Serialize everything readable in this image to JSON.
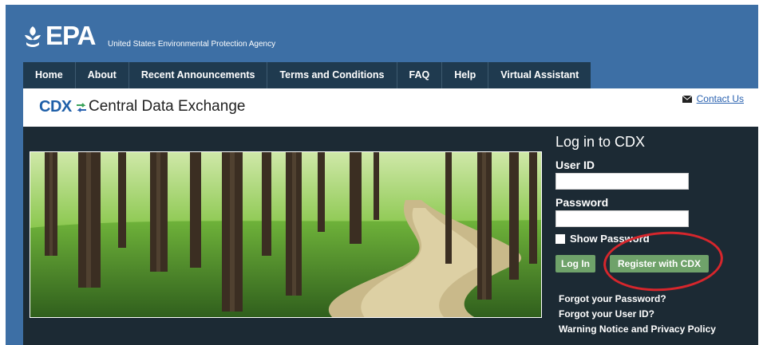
{
  "header": {
    "logo_text": "EPA",
    "agency": "United States Environmental Protection Agency"
  },
  "nav": {
    "items": [
      {
        "label": "Home"
      },
      {
        "label": "About"
      },
      {
        "label": "Recent Announcements"
      },
      {
        "label": "Terms and Conditions"
      },
      {
        "label": "FAQ"
      },
      {
        "label": "Help"
      },
      {
        "label": "Virtual Assistant"
      }
    ]
  },
  "banner": {
    "logo": "CDX",
    "title": "Central Data Exchange",
    "contact": "Contact Us"
  },
  "login": {
    "title": "Log in to CDX",
    "user_id_label": "User ID",
    "user_id_value": "",
    "password_label": "Password",
    "password_value": "",
    "show_password": "Show Password",
    "login_button": "Log In",
    "register_button": "Register with CDX",
    "links": [
      {
        "label": "Forgot your Password?"
      },
      {
        "label": "Forgot your User ID?"
      },
      {
        "label": "Warning Notice and Privacy Policy"
      }
    ]
  },
  "colors": {
    "frame_blue": "#3d6fa5",
    "nav_dark": "#1f3a4f",
    "content_dark": "#1c2a34",
    "button_green": "#6fa26a",
    "highlight_red": "#d6262c",
    "cdx_blue": "#1e5fa8"
  },
  "icons": [
    "epa-flower-icon",
    "cdx-arrows-icon",
    "envelope-icon"
  ]
}
